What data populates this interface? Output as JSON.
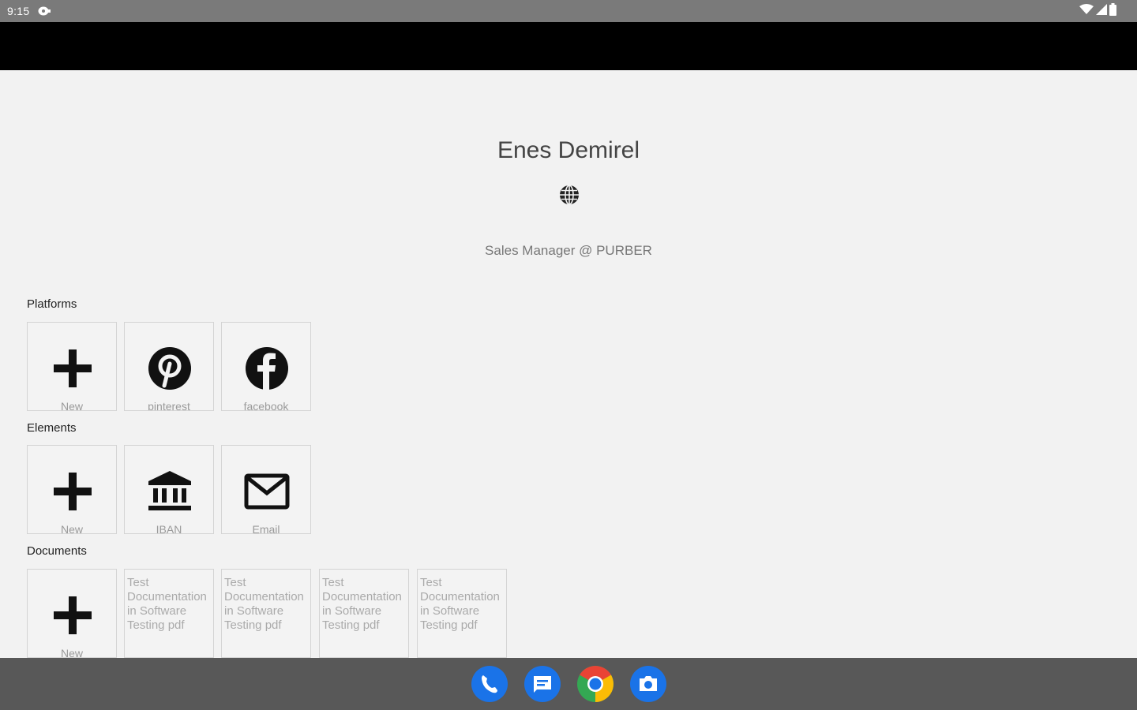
{
  "status_bar": {
    "time": "9:15"
  },
  "profile": {
    "name": "Enes Demirel",
    "title": "Sales Manager @ PURBER"
  },
  "sections": {
    "platforms": {
      "label": "Platforms",
      "tiles": [
        {
          "label": "New",
          "icon": "plus-icon"
        },
        {
          "label": "pinterest",
          "icon": "pinterest-icon"
        },
        {
          "label": "facebook",
          "icon": "facebook-icon"
        }
      ]
    },
    "elements": {
      "label": "Elements",
      "tiles": [
        {
          "label": "New",
          "icon": "plus-icon"
        },
        {
          "label": "IBAN",
          "icon": "bank-icon"
        },
        {
          "label": "Email",
          "icon": "mail-icon"
        }
      ]
    },
    "documents": {
      "label": "Documents",
      "tiles": [
        {
          "label": "New",
          "icon": "plus-icon"
        },
        {
          "text": "Test Documentation in Software Testing pdf"
        },
        {
          "text": "Test Documentation in Software Testing pdf"
        },
        {
          "text": "Test Documentation in Software Testing pdf"
        },
        {
          "text": "Test Documentation in Software Testing pdf"
        }
      ]
    }
  },
  "dock": [
    {
      "name": "Phone",
      "icon": "phone-icon"
    },
    {
      "name": "Messages",
      "icon": "messages-icon"
    },
    {
      "name": "Chrome",
      "icon": "chrome-icon"
    },
    {
      "name": "Camera",
      "icon": "camera-icon"
    }
  ],
  "colors": {
    "background": "#f2f2f2",
    "app_bar": "#000000",
    "status_bar": "#7a7a7a",
    "nav_bar": "#585858",
    "dock_blue": "#1a73e8"
  }
}
